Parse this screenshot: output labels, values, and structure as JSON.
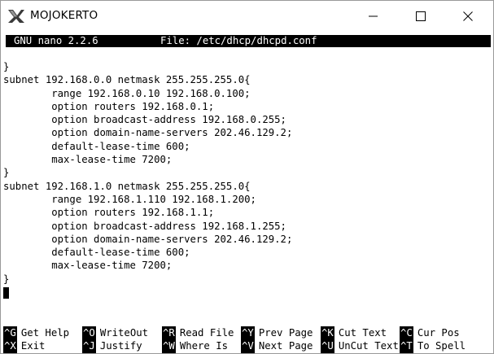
{
  "window": {
    "title": "MOJOKERTO"
  },
  "nano": {
    "version": "GNU nano 2.2.6",
    "file_label": "File: /etc/dhcp/dhcpd.conf"
  },
  "buffer": {
    "lines": [
      "}",
      "subnet 192.168.0.0 netmask 255.255.255.0{",
      "        range 192.168.0.10 192.168.0.100;",
      "        option routers 192.168.0.1;",
      "        option broadcast-address 192.168.0.255;",
      "        option domain-name-servers 202.46.129.2;",
      "        default-lease-time 600;",
      "        max-lease-time 7200;",
      "}",
      "subnet 192.168.1.0 netmask 255.255.255.0{",
      "        range 192.168.1.110 192.168.1.200;",
      "        option routers 192.168.1.1;",
      "        option broadcast-address 192.168.1.255;",
      "        option domain-name-servers 202.46.129.2;",
      "        default-lease-time 600;",
      "        max-lease-time 7200;",
      "}"
    ]
  },
  "shortcuts": {
    "row1": [
      {
        "key": "^G",
        "label": "Get Help"
      },
      {
        "key": "^O",
        "label": "WriteOut"
      },
      {
        "key": "^R",
        "label": "Read File"
      },
      {
        "key": "^Y",
        "label": "Prev Page"
      },
      {
        "key": "^K",
        "label": "Cut Text"
      },
      {
        "key": "^C",
        "label": "Cur Pos"
      }
    ],
    "row2": [
      {
        "key": "^X",
        "label": "Exit"
      },
      {
        "key": "^J",
        "label": "Justify"
      },
      {
        "key": "^W",
        "label": "Where Is"
      },
      {
        "key": "^V",
        "label": "Next Page"
      },
      {
        "key": "^U",
        "label": "UnCut Text"
      },
      {
        "key": "^T",
        "label": "To Spell"
      }
    ]
  }
}
